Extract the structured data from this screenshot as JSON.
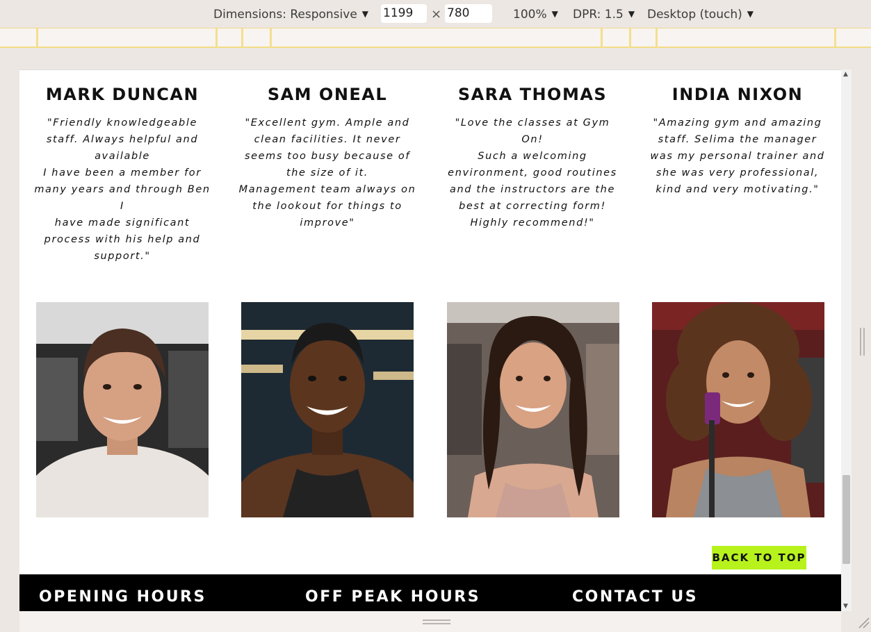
{
  "devtools": {
    "dimensions_label": "Dimensions: Responsive",
    "width_value": "1199",
    "times": "×",
    "height_value": "780",
    "zoom": "100%",
    "dpr": "DPR: 1.5",
    "device_mode": "Desktop (touch)"
  },
  "team": [
    {
      "name": "MARK DUNCAN",
      "quote": "\"Friendly knowledgeable\nstaff. Always helpful and\navailable\nI have been a member for\nmany years and through Ben I\nhave made significant\nprocess with his help and\nsupport.\""
    },
    {
      "name": "SAM ONEAL",
      "quote": "\"Excellent gym. Ample and\nclean facilities. It never\nseems too busy because of\nthe size of it.\nManagement team always on\nthe lookout for things to\nimprove\""
    },
    {
      "name": "SARA THOMAS",
      "quote": "\"Love the classes at Gym On!\nSuch a welcoming\nenvironment, good routines\nand the instructors are the\nbest at correcting form!\nHighly recommend!\""
    },
    {
      "name": "INDIA NIXON",
      "quote": "\"Amazing gym and amazing\nstaff. Selima the manager\nwas my personal trainer and\nshe was very professional,\nkind and very motivating.\""
    }
  ],
  "back_to_top": "BACK TO TOP",
  "footer": {
    "opening_hours": "OPENING HOURS",
    "off_peak_hours": "OFF PEAK HOURS",
    "contact_us": "CONTACT US"
  },
  "colors": {
    "accent": "#b7f21d",
    "footer_bg": "#000000"
  }
}
